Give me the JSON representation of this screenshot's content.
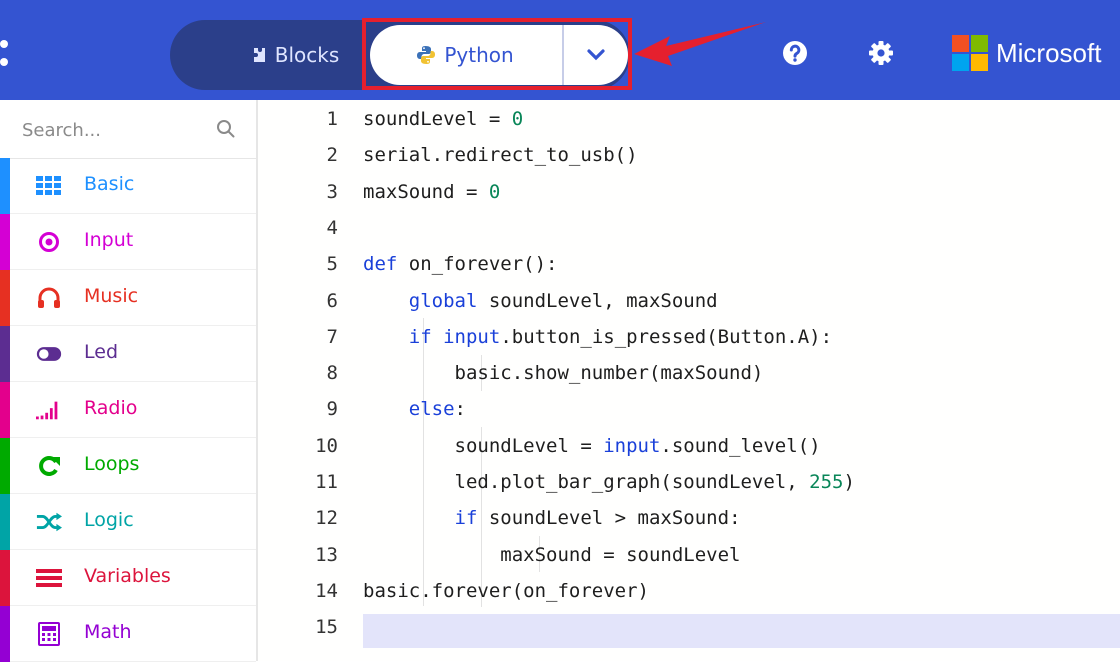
{
  "header": {
    "blocks_label": "Blocks",
    "python_label": "Python",
    "brand": "Microsoft",
    "icons": [
      "puzzle-icon",
      "python-icon",
      "chevron-down-icon",
      "help-icon",
      "gear-icon",
      "microsoft-logo"
    ]
  },
  "colors": {
    "header": "#3454d1",
    "highlight": "#e5202e",
    "keyword": "#1a40d9",
    "number": "#098658"
  },
  "sidebar": {
    "search_placeholder": "Search...",
    "categories": [
      {
        "label": "Basic",
        "color": "#1e90ff",
        "icon": "grid-icon"
      },
      {
        "label": "Input",
        "color": "#d400d4",
        "icon": "target-icon"
      },
      {
        "label": "Music",
        "color": "#e63022",
        "icon": "headphones-icon"
      },
      {
        "label": "Led",
        "color": "#5c2d91",
        "icon": "toggle-icon"
      },
      {
        "label": "Radio",
        "color": "#e3008c",
        "icon": "signal-bars-icon"
      },
      {
        "label": "Loops",
        "color": "#00aa00",
        "icon": "loop-arrow-icon"
      },
      {
        "label": "Logic",
        "color": "#00a4a6",
        "icon": "shuffle-icon"
      },
      {
        "label": "Variables",
        "color": "#dc143c",
        "icon": "lines-icon"
      },
      {
        "label": "Math",
        "color": "#9400d3",
        "icon": "calculator-icon"
      }
    ]
  },
  "editor": {
    "lines": [
      {
        "n": "1",
        "text": "soundLevel = 0"
      },
      {
        "n": "2",
        "text": "serial.redirect_to_usb()"
      },
      {
        "n": "3",
        "text": "maxSound = 0"
      },
      {
        "n": "4",
        "text": ""
      },
      {
        "n": "5",
        "text": "def on_forever():"
      },
      {
        "n": "6",
        "text": "    global soundLevel, maxSound"
      },
      {
        "n": "7",
        "text": "    if input.button_is_pressed(Button.A):"
      },
      {
        "n": "8",
        "text": "        basic.show_number(maxSound)"
      },
      {
        "n": "9",
        "text": "    else:"
      },
      {
        "n": "10",
        "text": "        soundLevel = input.sound_level()"
      },
      {
        "n": "11",
        "text": "        led.plot_bar_graph(soundLevel, 255)"
      },
      {
        "n": "12",
        "text": "        if soundLevel > maxSound:"
      },
      {
        "n": "13",
        "text": "            maxSound = soundLevel"
      },
      {
        "n": "14",
        "text": "basic.forever(on_forever)"
      },
      {
        "n": "15",
        "text": ""
      }
    ]
  }
}
